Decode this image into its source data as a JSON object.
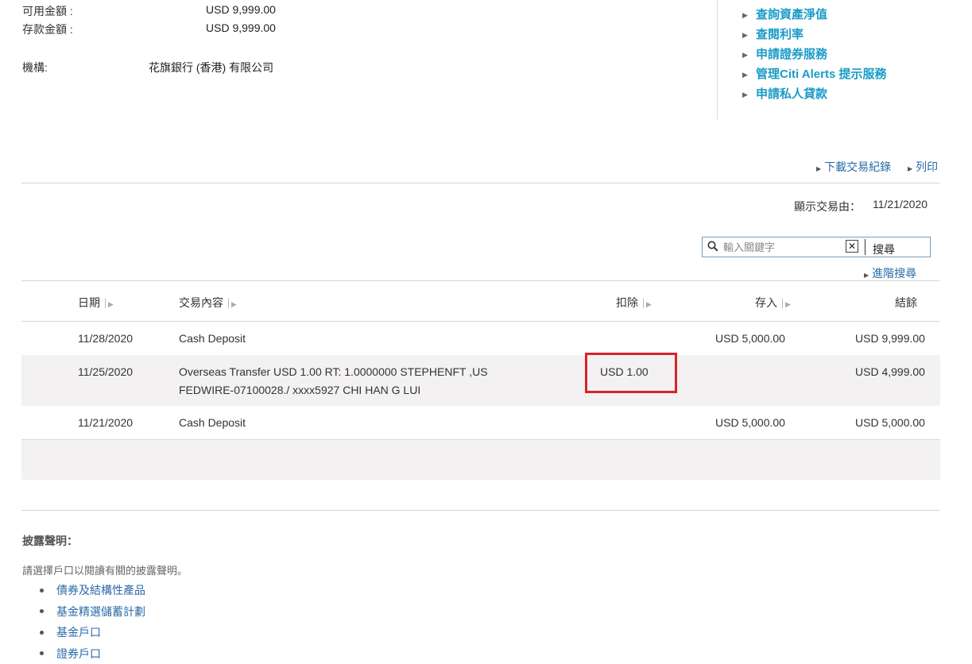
{
  "summary": {
    "available_label": "可用金額 :",
    "available_value": "USD 9,999.00",
    "deposit_label": "存款金額 :",
    "deposit_value": "USD 9,999.00",
    "institution_label": "機構:",
    "institution_value": "花旗銀行 (香港) 有限公司"
  },
  "quick_links": [
    {
      "label": "查詢資產淨值"
    },
    {
      "label": "查閱利率"
    },
    {
      "label": "申請證券服務"
    },
    {
      "label": "管理Citi Alerts 提示服務"
    },
    {
      "label": "申請私人貸款"
    }
  ],
  "actions": {
    "download_label": "下載交易紀錄",
    "print_label": "列印"
  },
  "date_filter": {
    "label": "顯示交易由：",
    "value": "11/21/2020"
  },
  "search": {
    "placeholder": "輸入關鍵字",
    "clear_glyph": "✕",
    "button_label": "搜尋",
    "advanced_label": "進階搜尋"
  },
  "table": {
    "headers": {
      "date": "日期",
      "description": "交易內容",
      "debit": "扣除",
      "credit": "存入",
      "balance": "結餘"
    },
    "rows": [
      {
        "date": "11/28/2020",
        "desc1": "Cash Deposit",
        "desc2": "",
        "debit": "",
        "credit": "USD 5,000.00",
        "balance": "USD 9,999.00"
      },
      {
        "date": "11/25/2020",
        "desc1": "Overseas Transfer USD 1.00 RT: 1.0000000 STEPHENFT ,US",
        "desc2": "FEDWIRE-07100028./ xxxx5927 CHI HAN G LUI",
        "debit": "USD 1.00",
        "credit": "",
        "balance": "USD 4,999.00"
      },
      {
        "date": "11/21/2020",
        "desc1": "Cash Deposit",
        "desc2": "",
        "debit": "",
        "credit": "USD 5,000.00",
        "balance": "USD 5,000.00"
      }
    ],
    "highlight_color": "#d9232a"
  },
  "disclosure": {
    "title": "披露聲明：",
    "text": "請選擇戶口以閱讀有關的披露聲明。",
    "items": [
      {
        "label": "債券及結構性產品"
      },
      {
        "label": "基金精選儲蓄計劃"
      },
      {
        "label": "基金戶口"
      },
      {
        "label": "證券戶口"
      }
    ]
  },
  "colors": {
    "quick_link": "#1a9bc7",
    "link": "#2a6aa8",
    "alt_row": "#f3f1f1"
  }
}
